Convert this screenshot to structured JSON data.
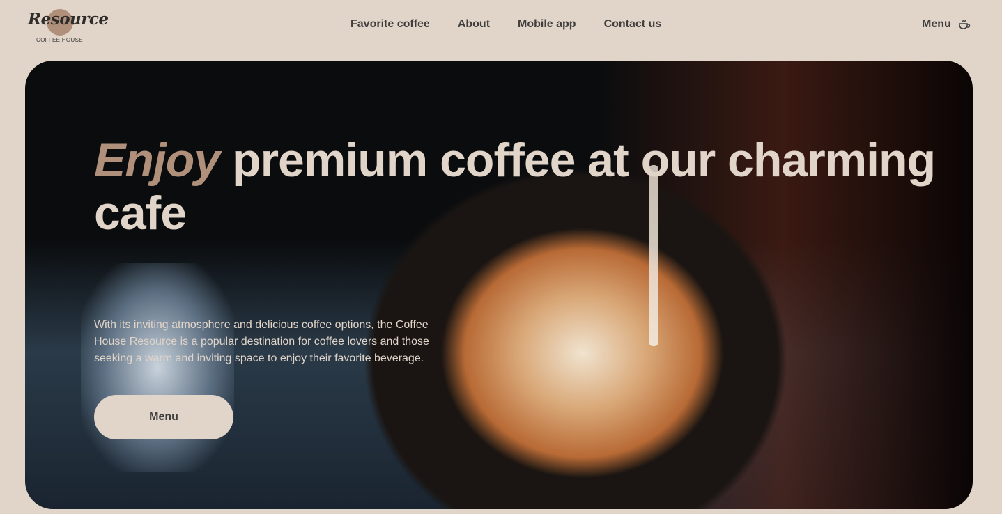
{
  "logo": {
    "word": "Resource",
    "sub": "COFFEE HOUSE"
  },
  "nav": [
    {
      "label": "Favorite coffee"
    },
    {
      "label": "About"
    },
    {
      "label": "Mobile app"
    },
    {
      "label": "Contact us"
    }
  ],
  "menu": {
    "label": "Menu",
    "icon": "coffee-cup-icon"
  },
  "hero": {
    "title_accent": "Enjoy",
    "title_rest": " premium coffee at our charming cafe",
    "description": "With its inviting atmosphere and delicious coffee options, the Coffee House Resource is a popular destination for coffee lovers and those seeking a warm and inviting space to enjoy their favorite beverage.",
    "button": "Menu"
  },
  "colors": {
    "background": "#e1d4c9",
    "accent": "#b0907a",
    "text": "#403f3d"
  }
}
